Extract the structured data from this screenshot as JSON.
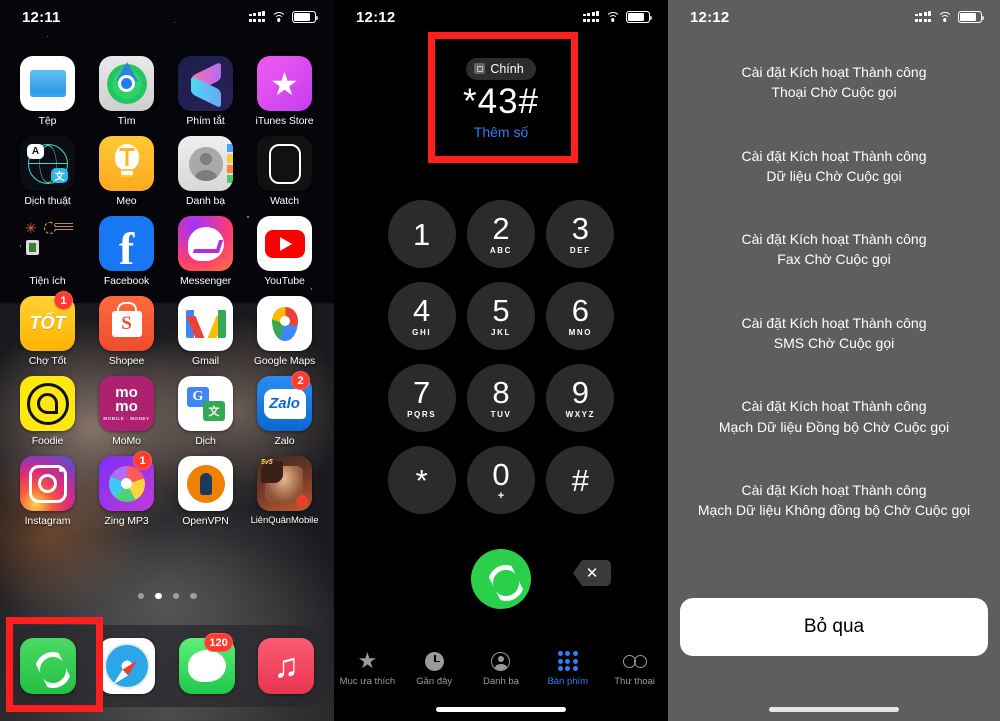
{
  "panels": {
    "home": {
      "status": {
        "time": "12:11"
      },
      "apps": [
        [
          {
            "label": "Tệp",
            "icon": "files-icon"
          },
          {
            "label": "Tìm",
            "icon": "find-my-icon"
          },
          {
            "label": "Phím tắt",
            "icon": "shortcuts-icon"
          },
          {
            "label": "iTunes Store",
            "icon": "itunes-store-icon"
          }
        ],
        [
          {
            "label": "Dịch thuật",
            "icon": "translate-icon"
          },
          {
            "label": "Mẹo",
            "icon": "tips-icon"
          },
          {
            "label": "Danh bạ",
            "icon": "contacts-icon"
          },
          {
            "label": "Watch",
            "icon": "watch-icon"
          }
        ],
        [
          {
            "label": "Tiện ích",
            "icon": "utilities-folder-icon"
          },
          {
            "label": "Facebook",
            "icon": "facebook-icon"
          },
          {
            "label": "Messenger",
            "icon": "messenger-icon"
          },
          {
            "label": "YouTube",
            "icon": "youtube-icon"
          }
        ],
        [
          {
            "label": "Chợ Tốt",
            "icon": "chotot-icon",
            "badge": "1"
          },
          {
            "label": "Shopee",
            "icon": "shopee-icon"
          },
          {
            "label": "Gmail",
            "icon": "gmail-icon"
          },
          {
            "label": "Google Maps",
            "icon": "google-maps-icon"
          }
        ],
        [
          {
            "label": "Foodie",
            "icon": "foodie-icon"
          },
          {
            "label": "MoMo",
            "icon": "momo-icon"
          },
          {
            "label": "Dịch",
            "icon": "google-translate-icon"
          },
          {
            "label": "Zalo",
            "icon": "zalo-icon",
            "badge": "2"
          }
        ],
        [
          {
            "label": "Instagram",
            "icon": "instagram-icon"
          },
          {
            "label": "Zing MP3",
            "icon": "zing-mp3-icon",
            "badge": "1"
          },
          {
            "label": "OpenVPN",
            "icon": "openvpn-icon"
          },
          {
            "label": "LiênQuânMobile",
            "icon": "lienquan-mobile-icon"
          }
        ]
      ],
      "momo_sub": "MOBILE · MONEY",
      "chotot_text": "TỐT",
      "shopee_letter": "S",
      "zalo_text": "Zalo",
      "facebook_letter": "f",
      "translate_a": "A",
      "translate_b": "文",
      "gtranslate_g": "G",
      "gtranslate_z": "文",
      "lq_tag": "5v5",
      "music_glyph": "♫",
      "itunes_star": "★",
      "page_dots": 4,
      "page_active_index": 1,
      "dock": [
        {
          "label": "Phone",
          "icon": "phone-icon"
        },
        {
          "label": "Safari",
          "icon": "safari-icon"
        },
        {
          "label": "Messages",
          "icon": "messages-icon",
          "badge": "120"
        },
        {
          "label": "Music",
          "icon": "music-icon"
        }
      ]
    },
    "dialer": {
      "status": {
        "time": "12:12"
      },
      "sim_label": "Chính",
      "number": "*43#",
      "add_number": "Thêm số",
      "keys": [
        {
          "digit": "1",
          "sub": ""
        },
        {
          "digit": "2",
          "sub": "ABC"
        },
        {
          "digit": "3",
          "sub": "DEF"
        },
        {
          "digit": "4",
          "sub": "GHI"
        },
        {
          "digit": "5",
          "sub": "JKL"
        },
        {
          "digit": "6",
          "sub": "MNO"
        },
        {
          "digit": "7",
          "sub": "PQRS"
        },
        {
          "digit": "8",
          "sub": "TUV"
        },
        {
          "digit": "9",
          "sub": "WXYZ"
        },
        {
          "digit": "*",
          "sub": ""
        },
        {
          "digit": "0",
          "sub": "+"
        },
        {
          "digit": "#",
          "sub": ""
        }
      ],
      "delete_glyph": "✕",
      "tabs": [
        {
          "label": "Mục ưa thích",
          "icon": "star-icon",
          "active": false
        },
        {
          "label": "Gần đây",
          "icon": "recents-clock-icon",
          "active": false
        },
        {
          "label": "Danh bạ",
          "icon": "contacts-icon",
          "active": false
        },
        {
          "label": "Bàn phím",
          "icon": "keypad-dots-icon",
          "active": true
        },
        {
          "label": "Thư thoại",
          "icon": "voicemail-icon",
          "active": false
        }
      ]
    },
    "result": {
      "status": {
        "time": "12:12"
      },
      "messages": [
        "Cài đặt Kích hoạt Thành công\nThoại Chờ Cuộc gọi",
        "Cài đặt Kích hoạt Thành công\nDữ liệu Chờ Cuộc gọi",
        "Cài đặt Kích hoạt Thành công\nFax Chờ Cuộc gọi",
        "Cài đặt Kích hoạt Thành công\nSMS Chờ Cuộc gọi",
        "Cài đặt Kích hoạt Thành công\nMạch Dữ liệu Đồng bộ Chờ Cuộc gọi",
        "Cài đặt Kích hoạt Thành công\nMạch Dữ liệu Không đồng bộ Chờ Cuộc gọi"
      ],
      "skip_button": "Bỏ qua",
      "background_color": "#5e5e5e"
    }
  },
  "annotations": {
    "highlight_color": "#ff1f1f",
    "boxes": [
      {
        "name": "phone-app-highlight",
        "panel": "home"
      },
      {
        "name": "dialed-code-highlight",
        "panel": "dialer"
      }
    ]
  }
}
